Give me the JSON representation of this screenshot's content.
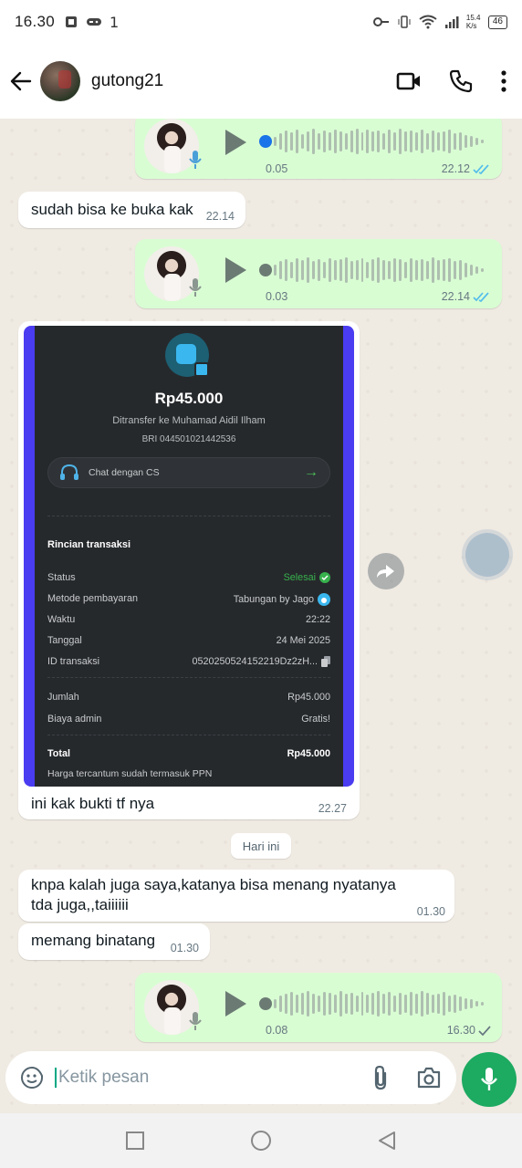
{
  "status_bar": {
    "time": "16.30",
    "speed": "15.4\nK/s",
    "battery": "46"
  },
  "header": {
    "contact_name": "gutong21"
  },
  "messages": {
    "voice1": {
      "duration": "0.05",
      "time": "22.12"
    },
    "text1": {
      "text": "sudah bisa ke buka kak",
      "time": "22.14"
    },
    "voice2": {
      "duration": "0.03",
      "time": "22.14"
    },
    "receipt": {
      "amount": "Rp45.000",
      "to": "Ditransfer ke Muhamad Aidil Ilham",
      "bank": "BRI 044501021442536",
      "chat_cs": "Chat dengan CS",
      "section": "Rincian transaksi",
      "rows": [
        {
          "label": "Status",
          "value": "Selesai"
        },
        {
          "label": "Metode pembayaran",
          "value": "Tabungan by Jago"
        },
        {
          "label": "Waktu",
          "value": "22:22"
        },
        {
          "label": "Tanggal",
          "value": "24 Mei 2025"
        },
        {
          "label": "ID transaksi",
          "value": "0520250524152219Dz2zH..."
        },
        {
          "label": "Jumlah",
          "value": "Rp45.000"
        },
        {
          "label": "Biaya admin",
          "value": "Gratis!"
        },
        {
          "label": "Total",
          "value": "Rp45.000"
        }
      ],
      "note": "Harga tercantum sudah termasuk PPN",
      "caption": "ini kak bukti tf nya",
      "time": "22.27"
    },
    "date_chip": "Hari ini",
    "text2": {
      "text": "knpa kalah juga saya,katanya bisa menang nyatanya tda juga,,taiiiiii",
      "time": "01.30"
    },
    "text3": {
      "text": "memang binatang",
      "time": "01.30"
    },
    "voice3": {
      "duration": "0.08",
      "time": "16.30"
    }
  },
  "input": {
    "placeholder": "Ketik pesan"
  },
  "colors": {
    "outgoing": "#d9fdd3",
    "incoming": "#ffffff",
    "accent": "#1daa61",
    "read_ticks": "#53bdeb",
    "seen_dot": "#1a73e8"
  }
}
